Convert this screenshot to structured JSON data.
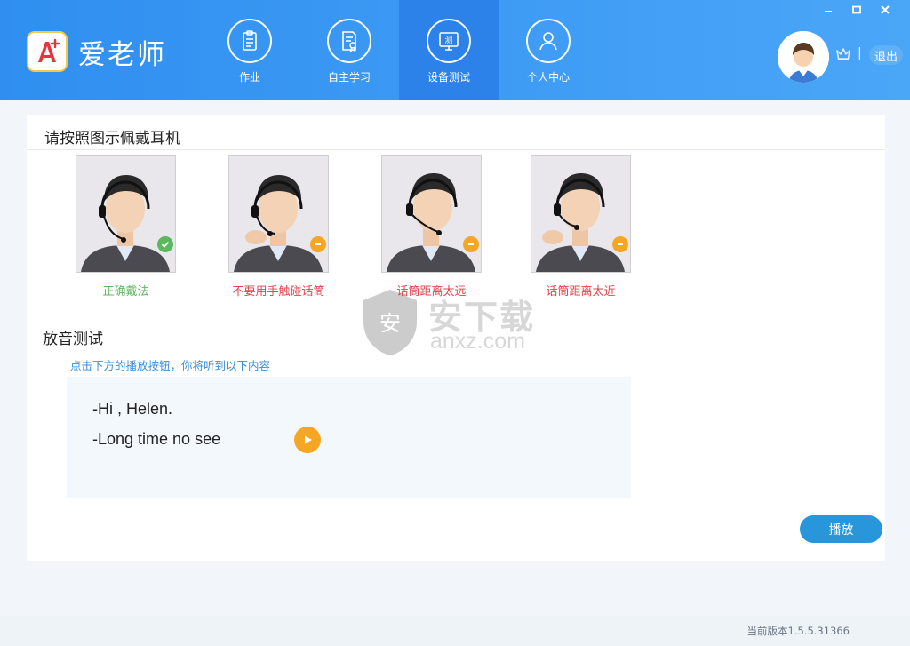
{
  "app": {
    "name": "爱老师",
    "logo_label": "A+"
  },
  "nav": {
    "items": [
      {
        "label": "作业",
        "icon": "clipboard-icon"
      },
      {
        "label": "自主学习",
        "icon": "certificate-icon"
      },
      {
        "label": "设备测试",
        "icon": "monitor-test-icon",
        "glyph": "测",
        "active": true
      },
      {
        "label": "个人中心",
        "icon": "user-icon"
      }
    ]
  },
  "user": {
    "separator": "|",
    "logout_label": "退出"
  },
  "window_controls": [
    "minimize",
    "maximize",
    "close"
  ],
  "headset_section": {
    "title": "请按照图示佩戴耳机",
    "examples": [
      {
        "caption": "正确戴法",
        "status": "correct",
        "color": "#5cb85c"
      },
      {
        "caption": "不要用手触碰话筒",
        "status": "warning",
        "color": "#e0464e"
      },
      {
        "caption": "话筒距离太远",
        "status": "warning",
        "color": "#e0464e"
      },
      {
        "caption": "话筒距离太近",
        "status": "warning",
        "color": "#e0464e"
      }
    ]
  },
  "playback_section": {
    "title": "放音测试",
    "hint": "点击下方的播放按钮，你将听到以下内容",
    "lines": [
      "-Hi , Helen.",
      "-Long time no see"
    ],
    "play_button_label": "播放"
  },
  "watermark": {
    "shield_glyph": "安",
    "text": "安下载",
    "url": "anxz.com"
  },
  "footer": {
    "version": "当前版本1.5.5.31366"
  },
  "colors": {
    "header_blue": "#3d9af4",
    "active_tab": "#2d82ea",
    "accent_orange": "#f5a623",
    "correct_green": "#5cb85c",
    "warning_red": "#e0464e",
    "play_button": "#2896db"
  }
}
